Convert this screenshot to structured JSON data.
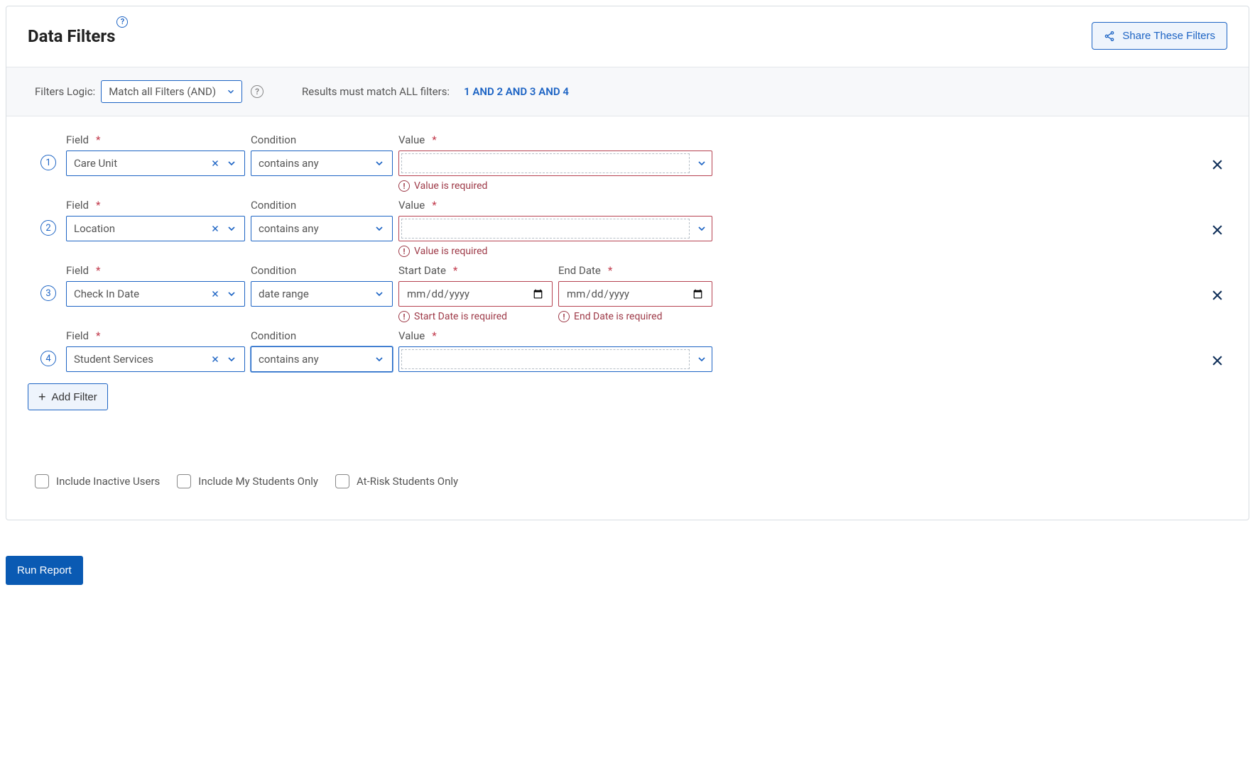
{
  "header": {
    "title": "Data Filters",
    "share_label": "Share These Filters"
  },
  "logic": {
    "label": "Filters Logic:",
    "selected": "Match all Filters (AND)",
    "results_prefix": "Results must match ALL filters:",
    "expression": "1 AND 2 AND 3 AND 4"
  },
  "labels": {
    "field": "Field",
    "condition": "Condition",
    "value": "Value",
    "start_date": "Start Date",
    "end_date": "End Date",
    "add_filter": "Add Filter",
    "run_report": "Run Report"
  },
  "errors": {
    "value_required": "Value is required",
    "start_date_required": "Start Date is required",
    "end_date_required": "End Date is required"
  },
  "filters": [
    {
      "num": "1",
      "field": "Care Unit",
      "condition": "contains any",
      "type": "multi",
      "value_required": true
    },
    {
      "num": "2",
      "field": "Location",
      "condition": "contains any",
      "type": "multi",
      "value_required": true
    },
    {
      "num": "3",
      "field": "Check In Date",
      "condition": "date range",
      "type": "daterange",
      "start_placeholder": "mm/dd/yyyy",
      "end_placeholder": "mm/dd/yyyy"
    },
    {
      "num": "4",
      "field": "Student Services",
      "condition": "contains any",
      "type": "multi",
      "value_required": false,
      "condition_active": true
    }
  ],
  "checkboxes": {
    "inactive": "Include Inactive Users",
    "my_students": "Include My Students Only",
    "at_risk": "At-Risk Students Only"
  }
}
